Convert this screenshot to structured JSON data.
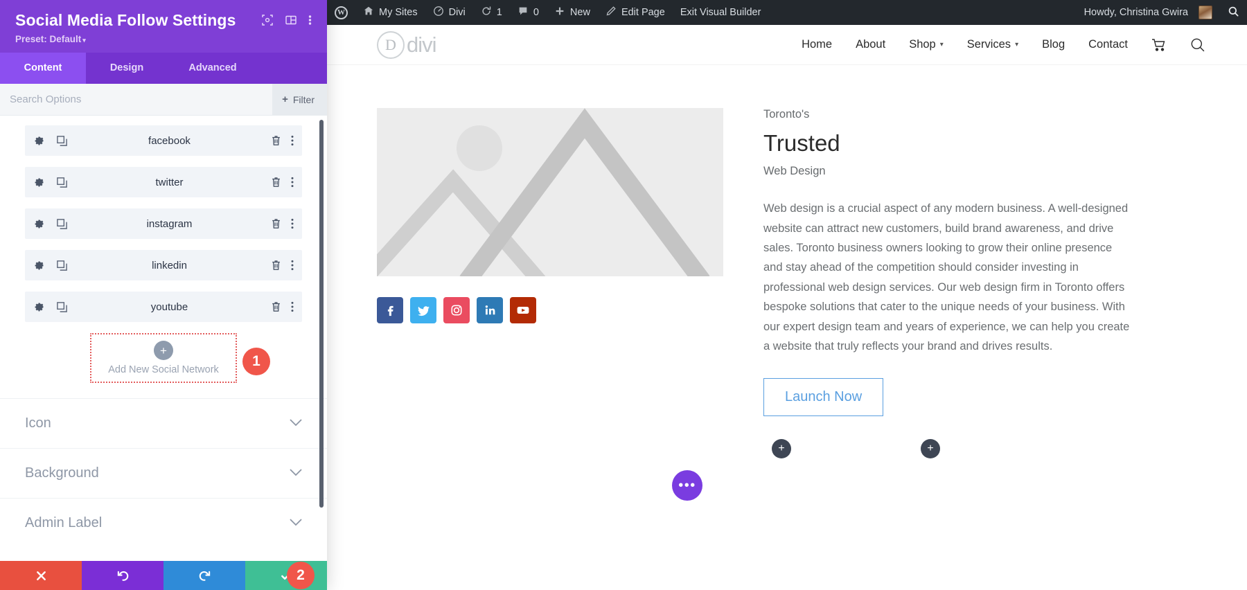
{
  "settings_panel": {
    "title": "Social Media Follow Settings",
    "preset_label": "Preset: Default",
    "header_icons": [
      {
        "name": "focus-target-icon"
      },
      {
        "name": "layout-columns-icon"
      },
      {
        "name": "kebab-menu-icon"
      }
    ],
    "tabs": [
      {
        "label": "Content",
        "active": true
      },
      {
        "label": "Design",
        "active": false
      },
      {
        "label": "Advanced",
        "active": false
      }
    ],
    "search": {
      "value": "",
      "placeholder": "Search Options"
    },
    "filter_button": {
      "label": "Filter",
      "plus": "+"
    },
    "social_rows": [
      {
        "label": "facebook"
      },
      {
        "label": "twitter"
      },
      {
        "label": "instagram"
      },
      {
        "label": "linkedin"
      },
      {
        "label": "youtube"
      }
    ],
    "add_network": {
      "label": "Add New Social Network",
      "plus": "+"
    },
    "badges": [
      {
        "name": "step-badge-1",
        "text": "1"
      },
      {
        "name": "step-badge-2",
        "text": "2"
      }
    ],
    "accordions": [
      {
        "label": "Icon"
      },
      {
        "label": "Background"
      },
      {
        "label": "Admin Label"
      }
    ],
    "footer_buttons": [
      {
        "name": "cancel-button",
        "icon": "x-icon"
      },
      {
        "name": "undo-button",
        "icon": "undo-icon"
      },
      {
        "name": "redo-button",
        "icon": "redo-icon"
      },
      {
        "name": "save-button",
        "icon": "check-icon"
      }
    ],
    "colors": {
      "header_purple": "#7f3fd6",
      "tab_active": "#8c4ff0",
      "badge_red": "#f0564a",
      "save_green": "#3fbf95"
    }
  },
  "admin_bar": {
    "items": [
      {
        "label": "",
        "icon": "wordpress-logo-icon"
      },
      {
        "label": "My Sites",
        "icon": "sites-icon"
      },
      {
        "label": "Divi",
        "icon": "divi-dashboard-icon"
      },
      {
        "label": "1",
        "icon": "updates-icon"
      },
      {
        "label": "0",
        "icon": "comments-icon"
      },
      {
        "label": "New",
        "icon": "plus-icon"
      },
      {
        "label": "Edit Page",
        "icon": "pencil-icon"
      },
      {
        "label": "Exit Visual Builder",
        "icon": ""
      }
    ],
    "howdy": "Howdy, Christina Gwira",
    "search_icon": "search-icon"
  },
  "site": {
    "logo_text": "divi",
    "logo_mark": "D",
    "nav": [
      {
        "label": "Home",
        "caret": false
      },
      {
        "label": "About",
        "caret": false
      },
      {
        "label": "Shop",
        "caret": true
      },
      {
        "label": "Services",
        "caret": true
      },
      {
        "label": "Blog",
        "caret": false
      },
      {
        "label": "Contact",
        "caret": false
      }
    ],
    "nav_icons": [
      {
        "name": "cart-icon"
      },
      {
        "name": "search-icon"
      }
    ],
    "social_icons": [
      {
        "name": "facebook-icon",
        "glyph": "f",
        "color": "#3b5998"
      },
      {
        "name": "twitter-icon",
        "glyph": "t",
        "color": "#3eb0ef"
      },
      {
        "name": "instagram-icon",
        "glyph": "i",
        "color": "#ea4c60"
      },
      {
        "name": "linkedin-icon",
        "glyph": "in",
        "color": "#2e7ab5"
      },
      {
        "name": "youtube-icon",
        "glyph": "y",
        "color": "#b32b05"
      }
    ],
    "hero": {
      "eyebrow": "Toronto's",
      "heading": "Trusted",
      "subheading": "Web Design",
      "paragraph": "Web design is a crucial aspect of any modern business. A well-designed website can attract new customers, build brand awareness, and drive sales. Toronto business owners looking to grow their online presence and stay ahead of the competition should consider investing in professional web design services. Our web design firm in Toronto offers bespoke solutions that cater to the unique needs of your business. With our expert design team and years of experience, we can help you create a website that truly reflects your brand and drives results.",
      "button_label": "Launch Now"
    },
    "floating": {
      "add_left": "+",
      "add_right": "+",
      "more_dots": "•••"
    }
  }
}
